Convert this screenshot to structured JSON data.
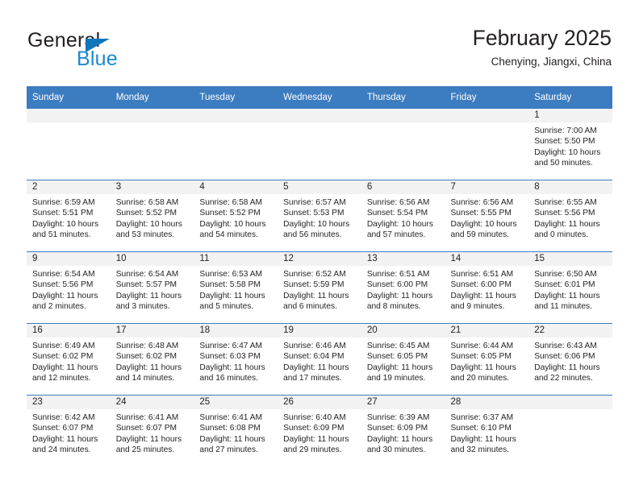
{
  "brand": {
    "name_top": "General",
    "name_bottom": "Blue",
    "triangle_color": "#1076bc",
    "blue_text_color": "#1b88d4"
  },
  "header": {
    "title": "February 2025",
    "subtitle": "Chenying, Jiangxi, China"
  },
  "theme": {
    "header_blue": "#3c7cc0",
    "daynum_band": "#f2f2f2",
    "text": "#231f20"
  },
  "weekday_headers": [
    "Sunday",
    "Monday",
    "Tuesday",
    "Wednesday",
    "Thursday",
    "Friday",
    "Saturday"
  ],
  "weeks": [
    [
      {
        "day": "",
        "sunrise": "",
        "sunset": "",
        "daylight": ""
      },
      {
        "day": "",
        "sunrise": "",
        "sunset": "",
        "daylight": ""
      },
      {
        "day": "",
        "sunrise": "",
        "sunset": "",
        "daylight": ""
      },
      {
        "day": "",
        "sunrise": "",
        "sunset": "",
        "daylight": ""
      },
      {
        "day": "",
        "sunrise": "",
        "sunset": "",
        "daylight": ""
      },
      {
        "day": "",
        "sunrise": "",
        "sunset": "",
        "daylight": ""
      },
      {
        "day": "1",
        "sunrise": "Sunrise: 7:00 AM",
        "sunset": "Sunset: 5:50 PM",
        "daylight": "Daylight: 10 hours and 50 minutes."
      }
    ],
    [
      {
        "day": "2",
        "sunrise": "Sunrise: 6:59 AM",
        "sunset": "Sunset: 5:51 PM",
        "daylight": "Daylight: 10 hours and 51 minutes."
      },
      {
        "day": "3",
        "sunrise": "Sunrise: 6:58 AM",
        "sunset": "Sunset: 5:52 PM",
        "daylight": "Daylight: 10 hours and 53 minutes."
      },
      {
        "day": "4",
        "sunrise": "Sunrise: 6:58 AM",
        "sunset": "Sunset: 5:52 PM",
        "daylight": "Daylight: 10 hours and 54 minutes."
      },
      {
        "day": "5",
        "sunrise": "Sunrise: 6:57 AM",
        "sunset": "Sunset: 5:53 PM",
        "daylight": "Daylight: 10 hours and 56 minutes."
      },
      {
        "day": "6",
        "sunrise": "Sunrise: 6:56 AM",
        "sunset": "Sunset: 5:54 PM",
        "daylight": "Daylight: 10 hours and 57 minutes."
      },
      {
        "day": "7",
        "sunrise": "Sunrise: 6:56 AM",
        "sunset": "Sunset: 5:55 PM",
        "daylight": "Daylight: 10 hours and 59 minutes."
      },
      {
        "day": "8",
        "sunrise": "Sunrise: 6:55 AM",
        "sunset": "Sunset: 5:56 PM",
        "daylight": "Daylight: 11 hours and 0 minutes."
      }
    ],
    [
      {
        "day": "9",
        "sunrise": "Sunrise: 6:54 AM",
        "sunset": "Sunset: 5:56 PM",
        "daylight": "Daylight: 11 hours and 2 minutes."
      },
      {
        "day": "10",
        "sunrise": "Sunrise: 6:54 AM",
        "sunset": "Sunset: 5:57 PM",
        "daylight": "Daylight: 11 hours and 3 minutes."
      },
      {
        "day": "11",
        "sunrise": "Sunrise: 6:53 AM",
        "sunset": "Sunset: 5:58 PM",
        "daylight": "Daylight: 11 hours and 5 minutes."
      },
      {
        "day": "12",
        "sunrise": "Sunrise: 6:52 AM",
        "sunset": "Sunset: 5:59 PM",
        "daylight": "Daylight: 11 hours and 6 minutes."
      },
      {
        "day": "13",
        "sunrise": "Sunrise: 6:51 AM",
        "sunset": "Sunset: 6:00 PM",
        "daylight": "Daylight: 11 hours and 8 minutes."
      },
      {
        "day": "14",
        "sunrise": "Sunrise: 6:51 AM",
        "sunset": "Sunset: 6:00 PM",
        "daylight": "Daylight: 11 hours and 9 minutes."
      },
      {
        "day": "15",
        "sunrise": "Sunrise: 6:50 AM",
        "sunset": "Sunset: 6:01 PM",
        "daylight": "Daylight: 11 hours and 11 minutes."
      }
    ],
    [
      {
        "day": "16",
        "sunrise": "Sunrise: 6:49 AM",
        "sunset": "Sunset: 6:02 PM",
        "daylight": "Daylight: 11 hours and 12 minutes."
      },
      {
        "day": "17",
        "sunrise": "Sunrise: 6:48 AM",
        "sunset": "Sunset: 6:02 PM",
        "daylight": "Daylight: 11 hours and 14 minutes."
      },
      {
        "day": "18",
        "sunrise": "Sunrise: 6:47 AM",
        "sunset": "Sunset: 6:03 PM",
        "daylight": "Daylight: 11 hours and 16 minutes."
      },
      {
        "day": "19",
        "sunrise": "Sunrise: 6:46 AM",
        "sunset": "Sunset: 6:04 PM",
        "daylight": "Daylight: 11 hours and 17 minutes."
      },
      {
        "day": "20",
        "sunrise": "Sunrise: 6:45 AM",
        "sunset": "Sunset: 6:05 PM",
        "daylight": "Daylight: 11 hours and 19 minutes."
      },
      {
        "day": "21",
        "sunrise": "Sunrise: 6:44 AM",
        "sunset": "Sunset: 6:05 PM",
        "daylight": "Daylight: 11 hours and 20 minutes."
      },
      {
        "day": "22",
        "sunrise": "Sunrise: 6:43 AM",
        "sunset": "Sunset: 6:06 PM",
        "daylight": "Daylight: 11 hours and 22 minutes."
      }
    ],
    [
      {
        "day": "23",
        "sunrise": "Sunrise: 6:42 AM",
        "sunset": "Sunset: 6:07 PM",
        "daylight": "Daylight: 11 hours and 24 minutes."
      },
      {
        "day": "24",
        "sunrise": "Sunrise: 6:41 AM",
        "sunset": "Sunset: 6:07 PM",
        "daylight": "Daylight: 11 hours and 25 minutes."
      },
      {
        "day": "25",
        "sunrise": "Sunrise: 6:41 AM",
        "sunset": "Sunset: 6:08 PM",
        "daylight": "Daylight: 11 hours and 27 minutes."
      },
      {
        "day": "26",
        "sunrise": "Sunrise: 6:40 AM",
        "sunset": "Sunset: 6:09 PM",
        "daylight": "Daylight: 11 hours and 29 minutes."
      },
      {
        "day": "27",
        "sunrise": "Sunrise: 6:39 AM",
        "sunset": "Sunset: 6:09 PM",
        "daylight": "Daylight: 11 hours and 30 minutes."
      },
      {
        "day": "28",
        "sunrise": "Sunrise: 6:37 AM",
        "sunset": "Sunset: 6:10 PM",
        "daylight": "Daylight: 11 hours and 32 minutes."
      },
      {
        "day": "",
        "sunrise": "",
        "sunset": "",
        "daylight": ""
      }
    ]
  ]
}
